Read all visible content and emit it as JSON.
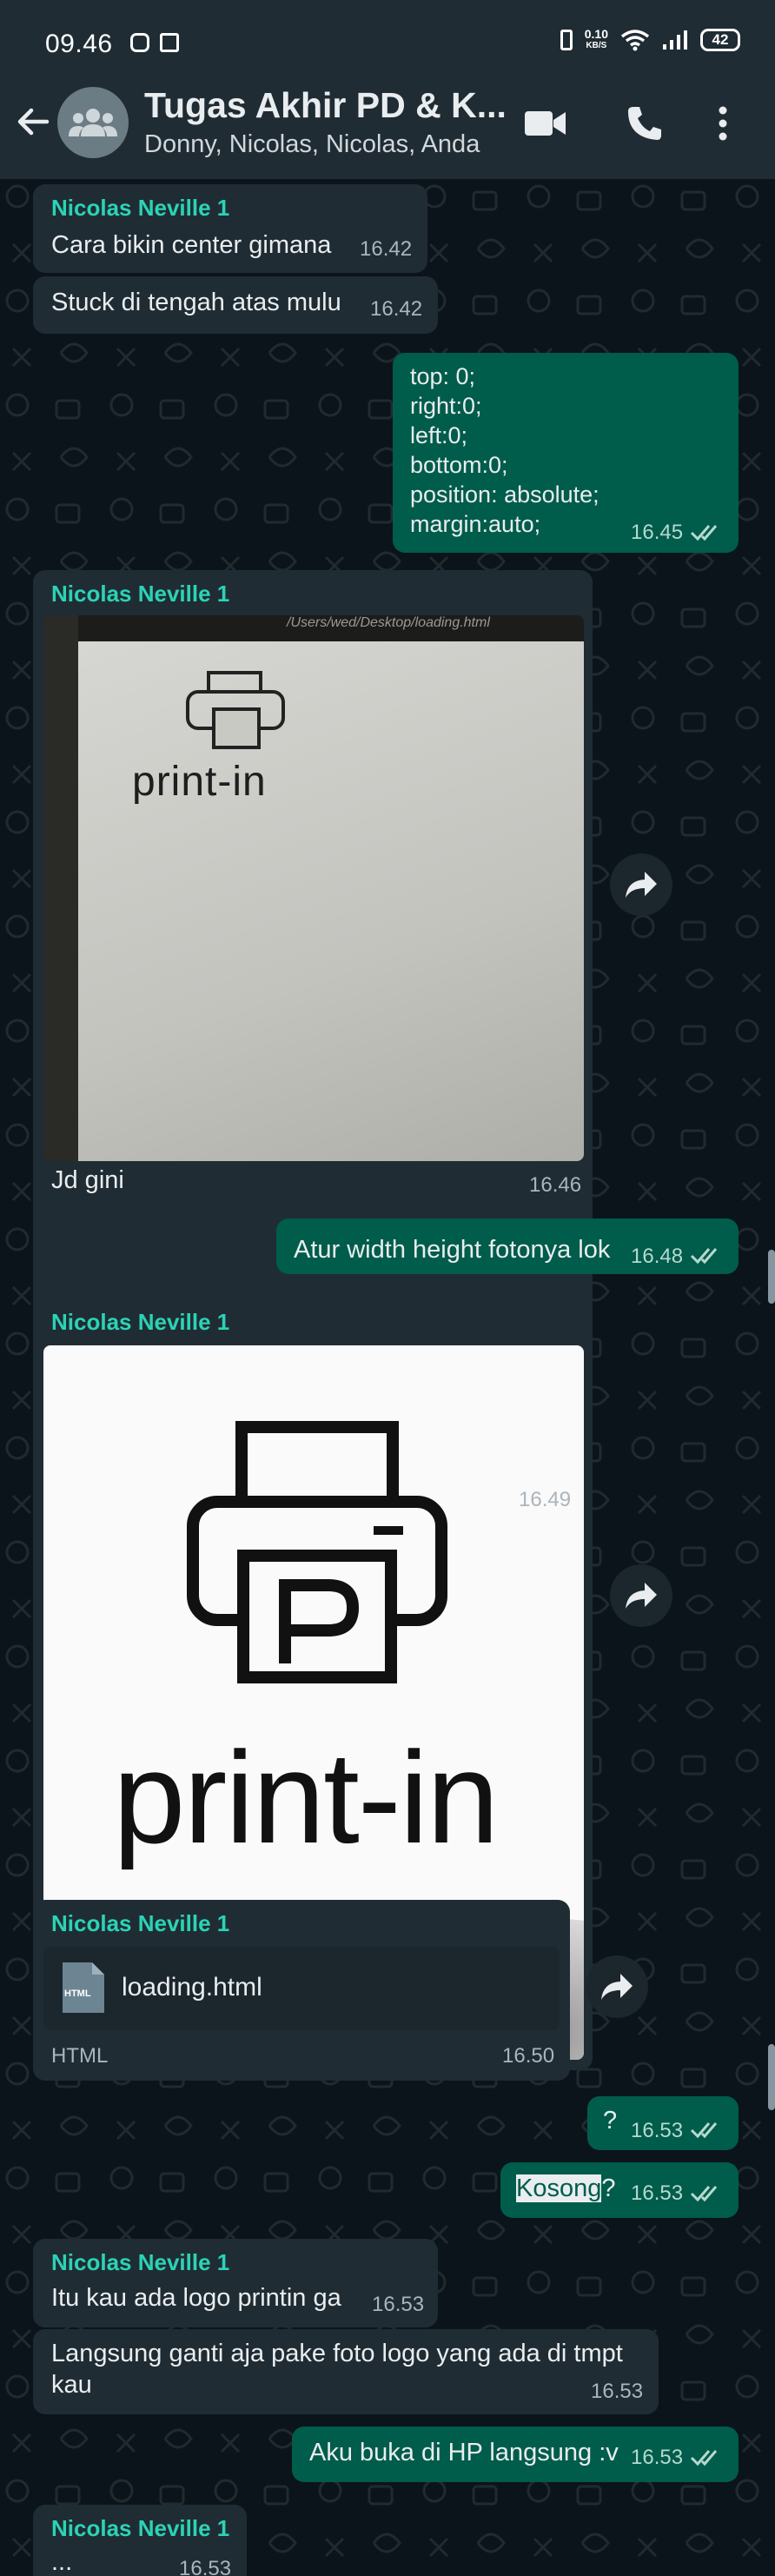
{
  "status": {
    "time": "09.46",
    "net_speed": "0.10",
    "net_unit": "KB/S",
    "battery": "42"
  },
  "header": {
    "title": "Tugas Akhir PD & K...",
    "subtitle": "Donny, Nicolas, Nicolas, Anda",
    "icons": [
      "back-arrow-icon",
      "group-avatar-icon",
      "video-call-icon",
      "voice-call-icon",
      "more-options-icon"
    ]
  },
  "messages": [
    {
      "sender": "Nicolas Neville 1",
      "text": "Cara bikin center gimana",
      "time": "16.42"
    },
    {
      "text": "Stuck di tengah atas mulu",
      "time": "16.42"
    },
    {
      "lines": [
        "top: 0;",
        "right:0;",
        "left:0;",
        "bottom:0;",
        "position: absolute;",
        "margin:auto;"
      ],
      "time": "16.45"
    },
    {
      "sender": "Nicolas Neville 1",
      "photo_url_text": "/Users/wed/Desktop/loading.html",
      "photo_logo": "print-in",
      "caption": "Jd gini",
      "time": "16.46"
    },
    {
      "text": "Atur width height fotonya lok",
      "time": "16.48"
    },
    {
      "sender": "Nicolas Neville 1",
      "photo_logo": "print-in",
      "time": "16.49"
    },
    {
      "sender": "Nicolas Neville 1",
      "file_icon": "HTML",
      "file_name": "loading.html",
      "file_type": "HTML",
      "time": "16.50"
    },
    {
      "text": "?",
      "time": "16.53"
    },
    {
      "text_highlight": "Kosong",
      "text_rest": "?",
      "time": "16.53"
    },
    {
      "sender": "Nicolas Neville 1",
      "text": "Itu kau ada logo printin ga",
      "time": "16.53"
    },
    {
      "text": "Langsung ganti aja pake foto logo yang ada di tmpt kau",
      "line1": "Langsung ganti aja pake foto logo yang ada di tmpt",
      "line2": "kau",
      "time": "16.53"
    },
    {
      "text": "Aku buka di HP langsung :v",
      "time": "16.53"
    },
    {
      "sender": "Nicolas Neville 1",
      "text": "...",
      "time": "16.53"
    }
  ],
  "colors": {
    "app_bar": "#1f2c34",
    "chat_bg": "#0b141a",
    "incoming": "#202c33",
    "outgoing": "#005c4b",
    "sender_name": "#2bd3b6"
  }
}
